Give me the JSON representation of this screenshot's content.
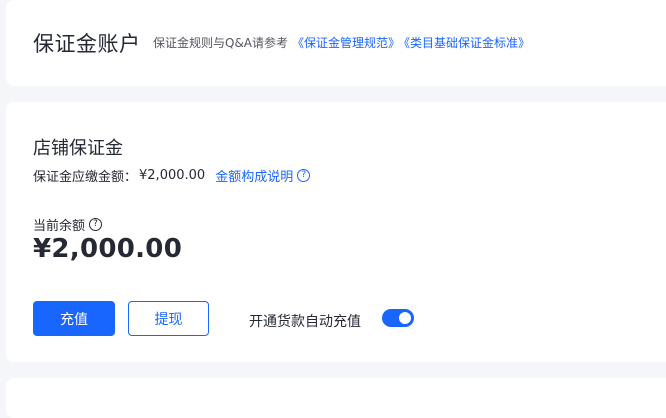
{
  "header": {
    "title": "保证金账户",
    "rules_intro": "保证金规则与Q&A请参考",
    "link_rules": "《保证金管理规范》",
    "link_standard": "《类目基础保证金标准》"
  },
  "deposit": {
    "section_title": "店铺保证金",
    "payable_label": "保证金应缴金额：",
    "payable_amount": "¥2,000.00",
    "explain_link": "金额构成说明",
    "balance_label": "当前余额",
    "balance_value": "¥2,000.00",
    "recharge_button": "充值",
    "withdraw_button": "提现",
    "auto_recharge_label": "开通货款自动充值",
    "auto_recharge_enabled": true
  },
  "icons": {
    "help": "question-circle-icon"
  },
  "colors": {
    "accent": "#1966ff",
    "text": "#252933",
    "background": "#f5f6fa"
  }
}
